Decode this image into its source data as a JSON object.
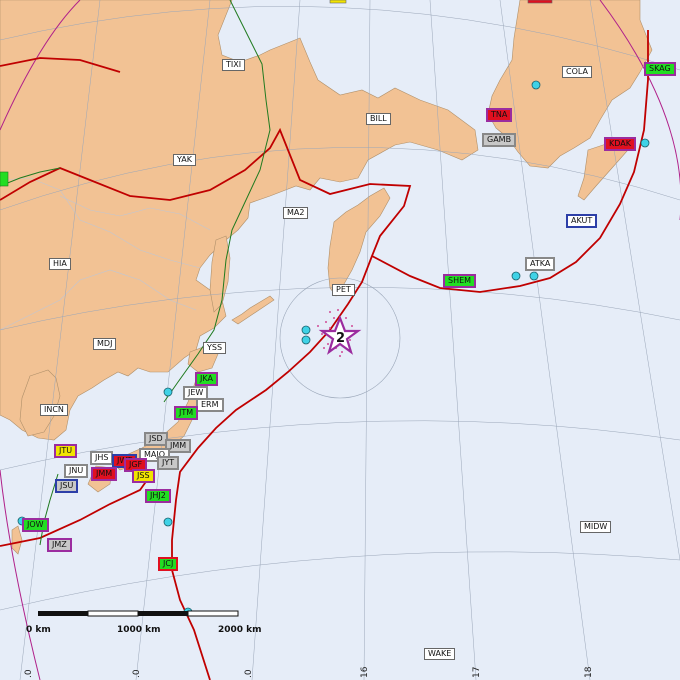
{
  "colors": {
    "ocean": "#e6edf8",
    "land": "#f2c294",
    "plate_boundary": "#c00000",
    "fault_green": "#1f7a1f",
    "graticule": "#9aa6b8",
    "great_circle": "#b0208a",
    "star": "#9b2c9f",
    "waveform_dot": "#3fd2e6",
    "station_green": "#22dd22",
    "station_red": "#e01020",
    "station_yellow": "#f2e400",
    "station_gray": "#c8c8c8",
    "station_white": "#ffffff"
  },
  "map": {
    "event_marker": {
      "label": "2",
      "icon": "star-icon"
    },
    "scale_bar": {
      "labels": [
        "0 km",
        "1000 km",
        "2000 km"
      ]
    },
    "tick_labels": [
      ".0",
      ".0",
      ".0",
      "16",
      "17",
      "18"
    ],
    "place_labels": [
      {
        "id": "tixi",
        "text": "TIXI"
      },
      {
        "id": "bill",
        "text": "BILL"
      },
      {
        "id": "yak",
        "text": "YAK"
      },
      {
        "id": "ma2",
        "text": "MA2"
      },
      {
        "id": "hia",
        "text": "HIA"
      },
      {
        "id": "mdj",
        "text": "MDJ"
      },
      {
        "id": "yss",
        "text": "YSS"
      },
      {
        "id": "pet",
        "text": "PET"
      },
      {
        "id": "incn",
        "text": "INCN"
      },
      {
        "id": "cola",
        "text": "COLA"
      },
      {
        "id": "midw",
        "text": "MIDW"
      },
      {
        "id": "wake",
        "text": "WAKE"
      }
    ],
    "stations": [
      {
        "id": "skag",
        "text": "SKAG",
        "color": "green",
        "border": "purple"
      },
      {
        "id": "tna",
        "text": "TNA",
        "color": "red",
        "border": "purple"
      },
      {
        "id": "gamb",
        "text": "GAMB",
        "color": "gray",
        "border": "gray"
      },
      {
        "id": "kdak",
        "text": "KDAK",
        "color": "red",
        "border": "purple"
      },
      {
        "id": "akut",
        "text": "AKUT",
        "color": "white",
        "border": "blue"
      },
      {
        "id": "atka",
        "text": "ATKA",
        "color": "white",
        "border": "gray"
      },
      {
        "id": "shem",
        "text": "SHEM",
        "color": "green",
        "border": "purple"
      },
      {
        "id": "jka",
        "text": "JKA",
        "color": "green",
        "border": "purple"
      },
      {
        "id": "jew",
        "text": "JEW",
        "color": "white",
        "border": "gray"
      },
      {
        "id": "erm",
        "text": "ERM",
        "color": "white",
        "border": "gray"
      },
      {
        "id": "jtm",
        "text": "JTM",
        "color": "green",
        "border": "purple"
      },
      {
        "id": "jsd",
        "text": "JSD",
        "color": "gray",
        "border": "gray"
      },
      {
        "id": "jmm",
        "text": "JMM",
        "color": "gray",
        "border": "gray"
      },
      {
        "id": "jtu",
        "text": "JTU",
        "color": "yellow",
        "border": "purple"
      },
      {
        "id": "jhs",
        "text": "JHS",
        "color": "white",
        "border": "gray"
      },
      {
        "id": "jwt",
        "text": "JWT",
        "color": "red",
        "border": "blue"
      },
      {
        "id": "majo",
        "text": "MAJO",
        "color": "white",
        "border": "gray"
      },
      {
        "id": "jyt",
        "text": "JYT",
        "color": "gray",
        "border": "gray"
      },
      {
        "id": "jgf",
        "text": "JGF",
        "color": "red",
        "border": "purple"
      },
      {
        "id": "jnu",
        "text": "JNU",
        "color": "white",
        "border": "gray"
      },
      {
        "id": "jmm2",
        "text": "JMM",
        "color": "red",
        "border": "purple"
      },
      {
        "id": "jss",
        "text": "JSS",
        "color": "yellow",
        "border": "purple"
      },
      {
        "id": "jsu",
        "text": "JSU",
        "color": "gray",
        "border": "blue"
      },
      {
        "id": "jhj2",
        "text": "JHJ2",
        "color": "green",
        "border": "purple"
      },
      {
        "id": "jow",
        "text": "JOW",
        "color": "green",
        "border": "purple"
      },
      {
        "id": "jmz",
        "text": "JMZ",
        "color": "gray",
        "border": "purple"
      },
      {
        "id": "jcj",
        "text": "JCJ",
        "color": "green",
        "border": "red"
      }
    ]
  }
}
